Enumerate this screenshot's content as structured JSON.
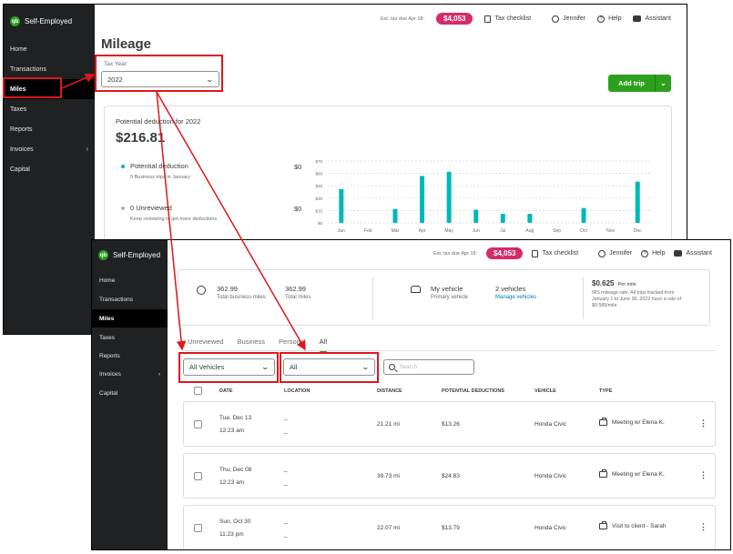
{
  "app": {
    "brand": "Self-Employed",
    "logo_text": "qb",
    "accent": "#2ca01c",
    "pill_color": "#d52b6a",
    "sidebar_bg": "#1f2123"
  },
  "topbar": {
    "tax_due_label": "Est. tax due Apr 18:",
    "tax_due_amount": "$4,053",
    "tax_checklist": "Tax checklist",
    "user": "Jennifer",
    "help": "Help",
    "assistant": "Assistant"
  },
  "sidebar": {
    "items": [
      {
        "label": "Home"
      },
      {
        "label": "Transactions"
      },
      {
        "label": "Miles"
      },
      {
        "label": "Taxes"
      },
      {
        "label": "Reports"
      },
      {
        "label": "Invoices",
        "chevron": "›"
      },
      {
        "label": "Capital"
      }
    ]
  },
  "mileage": {
    "title": "Mileage",
    "tax_year_label": "Tax Year:",
    "tax_year_value": "2022",
    "add_trip": "Add trip",
    "potential_label": "Potential deduction for 2022",
    "potential_value": "$216.81",
    "deduction_label": "Potential deduction",
    "deduction_sub": "0 Business trips in January",
    "deduction_amount": "$0",
    "unreviewed_label": "0 Unreviewed",
    "unreviewed_sub": "Keep reviewing to get more deductions",
    "unreviewed_amount": "$0"
  },
  "chart_data": {
    "type": "bar",
    "categories": [
      "Jan",
      "Feb",
      "Mar",
      "Apr",
      "May",
      "Jun",
      "Jul",
      "Aug",
      "Sep",
      "Oct",
      "Nov",
      "Dec"
    ],
    "values": [
      41,
      0,
      17,
      57,
      62,
      16,
      11,
      11,
      0,
      18,
      0,
      50
    ],
    "y_ticks": [
      "$0",
      "$15",
      "$30",
      "$45",
      "$60",
      "$75"
    ],
    "ylim": [
      0,
      75
    ],
    "bar_color": "#00b8b8",
    "grid": true
  },
  "summary": {
    "business_miles": "362.99",
    "business_miles_label": "Total business miles",
    "total_miles": "362.99",
    "total_miles_label": "Total miles",
    "vehicle_name": "My vehicle",
    "vehicle_sub": "Primary vehicle",
    "vehicle_count": "2 vehicles",
    "manage_vehicles": "Manage vehicles",
    "rate": "$0.625",
    "rate_unit": "Per mile",
    "rate_note_1": "IRS mileage rate. All trips tracked from",
    "rate_note_2": "January 1 to June 30, 2022 have a rate of",
    "rate_note_3": "$0.585/mile"
  },
  "tabs": [
    {
      "label": "Unreviewed"
    },
    {
      "label": "Business"
    },
    {
      "label": "Personal"
    },
    {
      "label": "All"
    }
  ],
  "filters": {
    "vehicle": "All Vehicles",
    "type": "All",
    "search_placeholder": "Search"
  },
  "table": {
    "columns": [
      "DATE",
      "LOCATION",
      "DISTANCE",
      "POTENTIAL DEDUCTIONS",
      "VEHICLE",
      "TYPE"
    ],
    "rows": [
      {
        "date": "Tue, Dec 13",
        "time": "12:23 am",
        "loc1": "–",
        "loc2": "–",
        "distance": "21.21 mi",
        "deduction": "$13.26",
        "vehicle": "Honda Civic",
        "type": "Meeting w/ Elena K."
      },
      {
        "date": "Thu, Dec 08",
        "time": "12:23 am",
        "loc1": "–",
        "loc2": "–",
        "distance": "39.73 mi",
        "deduction": "$24.83",
        "vehicle": "Honda Civic",
        "type": "Meeting w/ Elena K."
      },
      {
        "date": "Sun, Oct 30",
        "time": "11:23 pm",
        "loc1": "–",
        "loc2": "–",
        "distance": "22.07 mi",
        "deduction": "$13.79",
        "vehicle": "Honda Civic",
        "type": "Visit to client - Sarah"
      }
    ]
  },
  "icons": {
    "chevron_down": "⌄",
    "kebab": "⋮"
  }
}
